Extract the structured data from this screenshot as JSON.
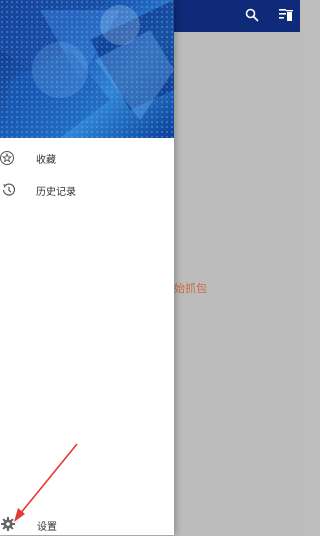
{
  "app": {
    "center_text": "始抓包",
    "appbar_icons": [
      "search-icon",
      "clear-list-icon"
    ]
  },
  "drawer": {
    "items": [
      {
        "label": "收藏",
        "icon": "favorite-star-icon"
      },
      {
        "label": "历史记录",
        "icon": "history-icon"
      }
    ],
    "settings": {
      "label": "设置",
      "icon": "gear-icon"
    }
  },
  "colors": {
    "appbar": "#0f2a78",
    "scrim_content": "#bcbcbc",
    "accent_text": "#d06a43",
    "arrow": "#e53935"
  }
}
